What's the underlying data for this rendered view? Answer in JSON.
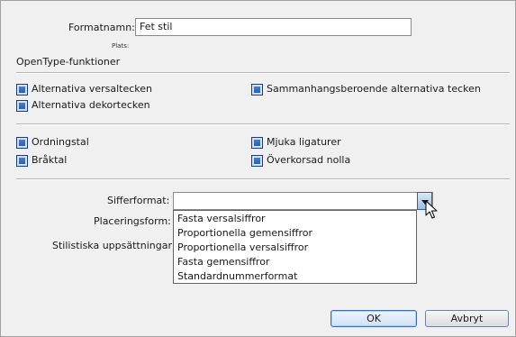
{
  "format_name": {
    "label": "Formatnamn:",
    "value": "Fet stil"
  },
  "location": {
    "label": "Plats:"
  },
  "section_title": "OpenType-funktioner",
  "group1": [
    {
      "label": "Alternativa versaltecken",
      "checked": true
    },
    {
      "label": "Sammanhangsberoende alternativa tecken",
      "checked": true
    },
    {
      "label": "Alternativa dekortecken",
      "checked": true
    }
  ],
  "group2": [
    {
      "label": "Ordningstal",
      "checked": true
    },
    {
      "label": "Mjuka ligaturer",
      "checked": true
    },
    {
      "label": "Bråktal",
      "checked": true
    },
    {
      "label": "Överkorsad nolla",
      "checked": true
    }
  ],
  "number_format": {
    "label": "Sifferformat:",
    "value": "",
    "options": [
      "Fasta versalsiffror",
      "Proportionella gemensiffror",
      "Proportionella versalsiffror",
      "Fasta gemensiffror",
      "Standardnummerformat"
    ]
  },
  "position": {
    "label": "Placeringsform:"
  },
  "stylistic_sets": {
    "label": "Stilistiska uppsättningar:"
  },
  "buttons": {
    "ok": "OK",
    "cancel": "Avbryt"
  },
  "colors": {
    "checkbox": "#2f6cc4",
    "accent_border": "#3b6fb8"
  },
  "icons": {
    "checkbox": "checked-checkbox-icon",
    "dropdown": "chevron-down-icon",
    "pointer": "mouse-pointer-icon"
  }
}
